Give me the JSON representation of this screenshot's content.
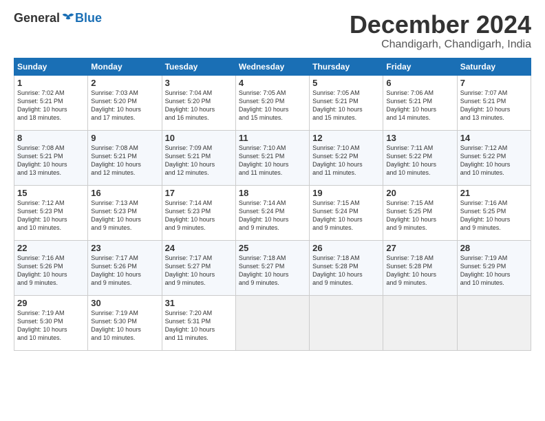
{
  "logo": {
    "general": "General",
    "blue": "Blue"
  },
  "header": {
    "month": "December 2024",
    "location": "Chandigarh, Chandigarh, India"
  },
  "days_of_week": [
    "Sunday",
    "Monday",
    "Tuesday",
    "Wednesday",
    "Thursday",
    "Friday",
    "Saturday"
  ],
  "weeks": [
    [
      {
        "day": "1",
        "info": "Sunrise: 7:02 AM\nSunset: 5:21 PM\nDaylight: 10 hours\nand 18 minutes."
      },
      {
        "day": "2",
        "info": "Sunrise: 7:03 AM\nSunset: 5:20 PM\nDaylight: 10 hours\nand 17 minutes."
      },
      {
        "day": "3",
        "info": "Sunrise: 7:04 AM\nSunset: 5:20 PM\nDaylight: 10 hours\nand 16 minutes."
      },
      {
        "day": "4",
        "info": "Sunrise: 7:05 AM\nSunset: 5:20 PM\nDaylight: 10 hours\nand 15 minutes."
      },
      {
        "day": "5",
        "info": "Sunrise: 7:05 AM\nSunset: 5:21 PM\nDaylight: 10 hours\nand 15 minutes."
      },
      {
        "day": "6",
        "info": "Sunrise: 7:06 AM\nSunset: 5:21 PM\nDaylight: 10 hours\nand 14 minutes."
      },
      {
        "day": "7",
        "info": "Sunrise: 7:07 AM\nSunset: 5:21 PM\nDaylight: 10 hours\nand 13 minutes."
      }
    ],
    [
      {
        "day": "8",
        "info": "Sunrise: 7:08 AM\nSunset: 5:21 PM\nDaylight: 10 hours\nand 13 minutes."
      },
      {
        "day": "9",
        "info": "Sunrise: 7:08 AM\nSunset: 5:21 PM\nDaylight: 10 hours\nand 12 minutes."
      },
      {
        "day": "10",
        "info": "Sunrise: 7:09 AM\nSunset: 5:21 PM\nDaylight: 10 hours\nand 12 minutes."
      },
      {
        "day": "11",
        "info": "Sunrise: 7:10 AM\nSunset: 5:21 PM\nDaylight: 10 hours\nand 11 minutes."
      },
      {
        "day": "12",
        "info": "Sunrise: 7:10 AM\nSunset: 5:22 PM\nDaylight: 10 hours\nand 11 minutes."
      },
      {
        "day": "13",
        "info": "Sunrise: 7:11 AM\nSunset: 5:22 PM\nDaylight: 10 hours\nand 10 minutes."
      },
      {
        "day": "14",
        "info": "Sunrise: 7:12 AM\nSunset: 5:22 PM\nDaylight: 10 hours\nand 10 minutes."
      }
    ],
    [
      {
        "day": "15",
        "info": "Sunrise: 7:12 AM\nSunset: 5:23 PM\nDaylight: 10 hours\nand 10 minutes."
      },
      {
        "day": "16",
        "info": "Sunrise: 7:13 AM\nSunset: 5:23 PM\nDaylight: 10 hours\nand 9 minutes."
      },
      {
        "day": "17",
        "info": "Sunrise: 7:14 AM\nSunset: 5:23 PM\nDaylight: 10 hours\nand 9 minutes."
      },
      {
        "day": "18",
        "info": "Sunrise: 7:14 AM\nSunset: 5:24 PM\nDaylight: 10 hours\nand 9 minutes."
      },
      {
        "day": "19",
        "info": "Sunrise: 7:15 AM\nSunset: 5:24 PM\nDaylight: 10 hours\nand 9 minutes."
      },
      {
        "day": "20",
        "info": "Sunrise: 7:15 AM\nSunset: 5:25 PM\nDaylight: 10 hours\nand 9 minutes."
      },
      {
        "day": "21",
        "info": "Sunrise: 7:16 AM\nSunset: 5:25 PM\nDaylight: 10 hours\nand 9 minutes."
      }
    ],
    [
      {
        "day": "22",
        "info": "Sunrise: 7:16 AM\nSunset: 5:26 PM\nDaylight: 10 hours\nand 9 minutes."
      },
      {
        "day": "23",
        "info": "Sunrise: 7:17 AM\nSunset: 5:26 PM\nDaylight: 10 hours\nand 9 minutes."
      },
      {
        "day": "24",
        "info": "Sunrise: 7:17 AM\nSunset: 5:27 PM\nDaylight: 10 hours\nand 9 minutes."
      },
      {
        "day": "25",
        "info": "Sunrise: 7:18 AM\nSunset: 5:27 PM\nDaylight: 10 hours\nand 9 minutes."
      },
      {
        "day": "26",
        "info": "Sunrise: 7:18 AM\nSunset: 5:28 PM\nDaylight: 10 hours\nand 9 minutes."
      },
      {
        "day": "27",
        "info": "Sunrise: 7:18 AM\nSunset: 5:28 PM\nDaylight: 10 hours\nand 9 minutes."
      },
      {
        "day": "28",
        "info": "Sunrise: 7:19 AM\nSunset: 5:29 PM\nDaylight: 10 hours\nand 10 minutes."
      }
    ],
    [
      {
        "day": "29",
        "info": "Sunrise: 7:19 AM\nSunset: 5:30 PM\nDaylight: 10 hours\nand 10 minutes."
      },
      {
        "day": "30",
        "info": "Sunrise: 7:19 AM\nSunset: 5:30 PM\nDaylight: 10 hours\nand 10 minutes."
      },
      {
        "day": "31",
        "info": "Sunrise: 7:20 AM\nSunset: 5:31 PM\nDaylight: 10 hours\nand 11 minutes."
      },
      null,
      null,
      null,
      null
    ]
  ]
}
